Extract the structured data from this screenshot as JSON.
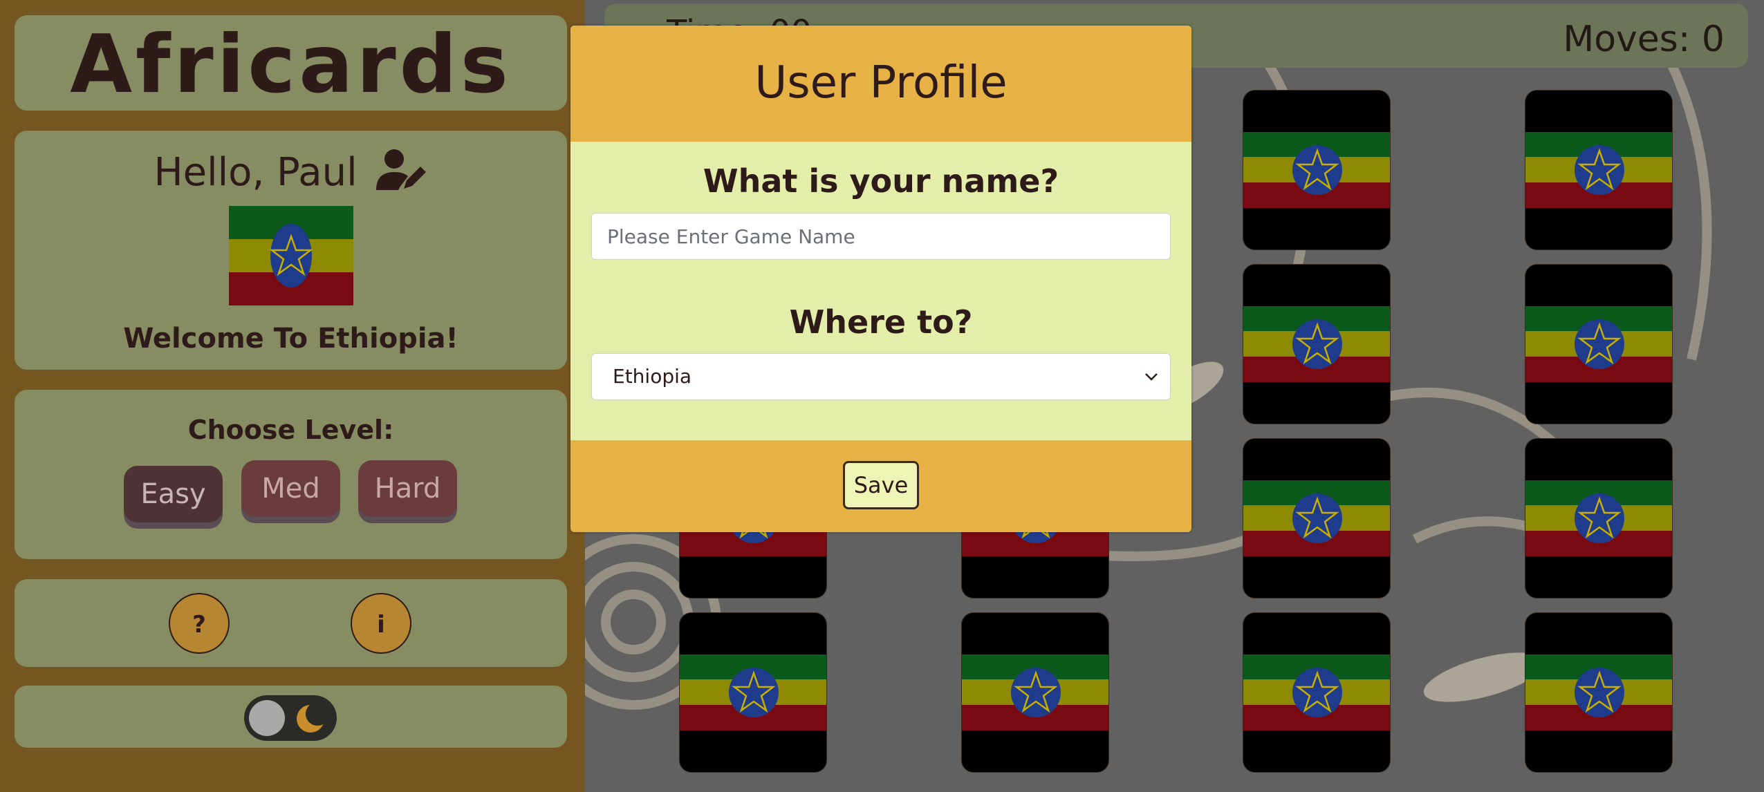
{
  "sidebar": {
    "app_title": "Africards",
    "greeting": "Hello, Paul",
    "welcome": "Welcome To Ethiopia!",
    "level_label": "Choose Level:",
    "levels": [
      "Easy",
      "Med",
      "Hard"
    ],
    "help_label": "?",
    "info_label": "i"
  },
  "topbar": {
    "timer": "Time: 00",
    "moves": "Moves: 0"
  },
  "modal": {
    "title": "User Profile",
    "name_question": "What is your name?",
    "name_placeholder": "Please Enter Game Name",
    "name_value": "",
    "where_question": "Where to?",
    "selected_country": "Ethiopia",
    "save_label": "Save"
  },
  "colors": {
    "sidebar_bg": "#765620",
    "panel_bg": "#868d62",
    "modal_header": "#e6b245",
    "modal_body": "#e3eeaa",
    "flag_green": "#0b5a1c",
    "flag_yellow": "#8f8a04",
    "flag_red": "#7a0a12",
    "flag_emblem": "#1f3c8c"
  },
  "icons": {
    "edit": "user-pen-icon",
    "dark_mode": "moon-icon",
    "dropdown": "chevron-down-icon"
  }
}
